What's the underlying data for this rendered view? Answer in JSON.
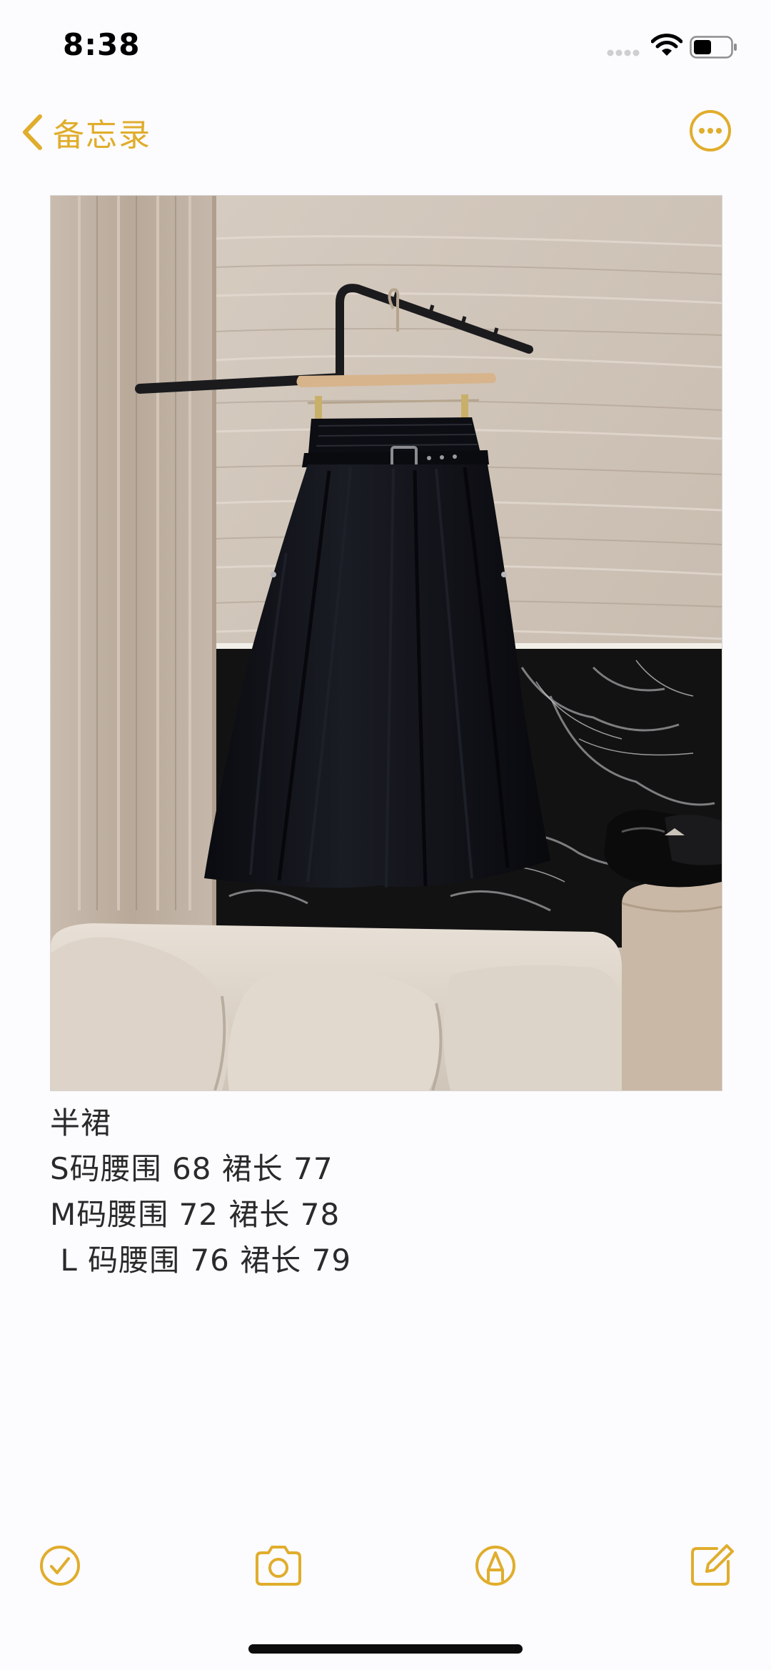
{
  "status_bar": {
    "time": "8:38"
  },
  "nav": {
    "back_label": "备忘录",
    "back_icon": "chevron-left-icon",
    "more_icon": "ellipsis-circle-icon"
  },
  "note": {
    "image_description": "photo-of-black-belted-skirt-on-hanger",
    "lines": [
      "半裙",
      "S码腰围 68 裙长 77",
      "M码腰围 72 裙长 78",
      " L 码腰围 76 裙长 79"
    ]
  },
  "toolbar": {
    "items": [
      "checklist-icon",
      "camera-icon",
      "markup-icon",
      "compose-icon"
    ]
  },
  "colors": {
    "accent": "#e0ad2c",
    "background": "#fcfbfd",
    "text": "#2a2a2a"
  }
}
